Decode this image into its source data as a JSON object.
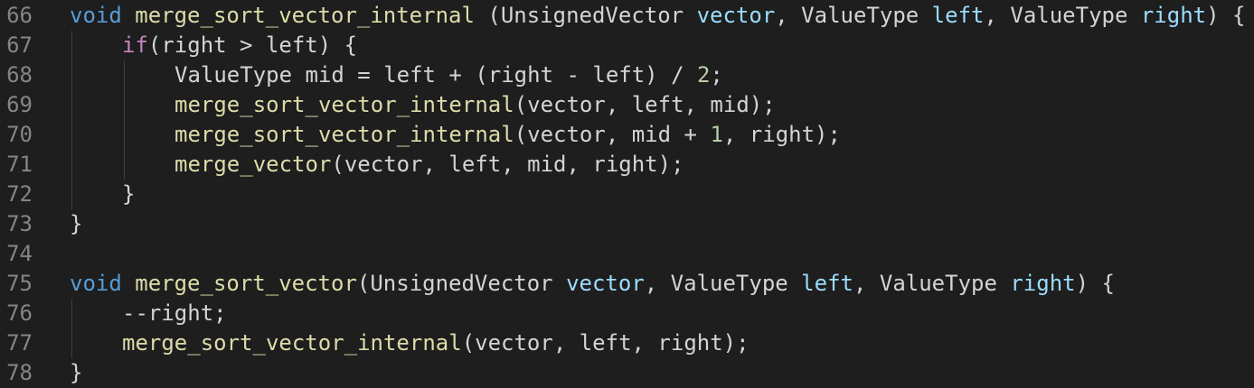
{
  "colors": {
    "background": "#1e1e1e",
    "line_number": "#858585",
    "keyword": "#569cd6",
    "control_keyword": "#c586c0",
    "function": "#dcdcaa",
    "parameter": "#9cdcfe",
    "number": "#b5cea8",
    "text": "#d4d4d4",
    "indent_guide": "#404040"
  },
  "lines": [
    {
      "number": "66",
      "indent": 0,
      "tokens": [
        {
          "t": "void",
          "c": "kw"
        },
        {
          "t": " ",
          "c": "txt"
        },
        {
          "t": "merge_sort_vector_internal",
          "c": "fn"
        },
        {
          "t": " (UnsignedVector ",
          "c": "txt"
        },
        {
          "t": "vector",
          "c": "param"
        },
        {
          "t": ", ValueType ",
          "c": "txt"
        },
        {
          "t": "left",
          "c": "param"
        },
        {
          "t": ", ValueType ",
          "c": "txt"
        },
        {
          "t": "right",
          "c": "param"
        },
        {
          "t": ") {",
          "c": "txt"
        }
      ]
    },
    {
      "number": "67",
      "indent": 1,
      "tokens": [
        {
          "t": "if",
          "c": "ctl"
        },
        {
          "t": "(right > left) {",
          "c": "txt"
        }
      ]
    },
    {
      "number": "68",
      "indent": 2,
      "tokens": [
        {
          "t": "ValueType mid = left + (right - left) / ",
          "c": "txt"
        },
        {
          "t": "2",
          "c": "num"
        },
        {
          "t": ";",
          "c": "txt"
        }
      ]
    },
    {
      "number": "69",
      "indent": 2,
      "tokens": [
        {
          "t": "merge_sort_vector_internal",
          "c": "fn"
        },
        {
          "t": "(vector, left, mid);",
          "c": "txt"
        }
      ]
    },
    {
      "number": "70",
      "indent": 2,
      "tokens": [
        {
          "t": "merge_sort_vector_internal",
          "c": "fn"
        },
        {
          "t": "(vector, mid + ",
          "c": "txt"
        },
        {
          "t": "1",
          "c": "num"
        },
        {
          "t": ", right);",
          "c": "txt"
        }
      ]
    },
    {
      "number": "71",
      "indent": 2,
      "tokens": [
        {
          "t": "merge_vector",
          "c": "fn"
        },
        {
          "t": "(vector, left, mid, right);",
          "c": "txt"
        }
      ]
    },
    {
      "number": "72",
      "indent": 1,
      "tokens": [
        {
          "t": "}",
          "c": "txt"
        }
      ]
    },
    {
      "number": "73",
      "indent": 0,
      "tokens": [
        {
          "t": "}",
          "c": "txt"
        }
      ]
    },
    {
      "number": "74",
      "indent": 0,
      "tokens": []
    },
    {
      "number": "75",
      "indent": 0,
      "tokens": [
        {
          "t": "void",
          "c": "kw"
        },
        {
          "t": " ",
          "c": "txt"
        },
        {
          "t": "merge_sort_vector",
          "c": "fn"
        },
        {
          "t": "(UnsignedVector ",
          "c": "txt"
        },
        {
          "t": "vector",
          "c": "param"
        },
        {
          "t": ", ValueType ",
          "c": "txt"
        },
        {
          "t": "left",
          "c": "param"
        },
        {
          "t": ", ValueType ",
          "c": "txt"
        },
        {
          "t": "right",
          "c": "param"
        },
        {
          "t": ") {",
          "c": "txt"
        }
      ]
    },
    {
      "number": "76",
      "indent": 1,
      "tokens": [
        {
          "t": "--right;",
          "c": "txt"
        }
      ]
    },
    {
      "number": "77",
      "indent": 1,
      "tokens": [
        {
          "t": "merge_sort_vector_internal",
          "c": "fn"
        },
        {
          "t": "(vector, left, right);",
          "c": "txt"
        }
      ]
    },
    {
      "number": "78",
      "indent": 0,
      "tokens": [
        {
          "t": "}",
          "c": "txt"
        }
      ]
    }
  ]
}
